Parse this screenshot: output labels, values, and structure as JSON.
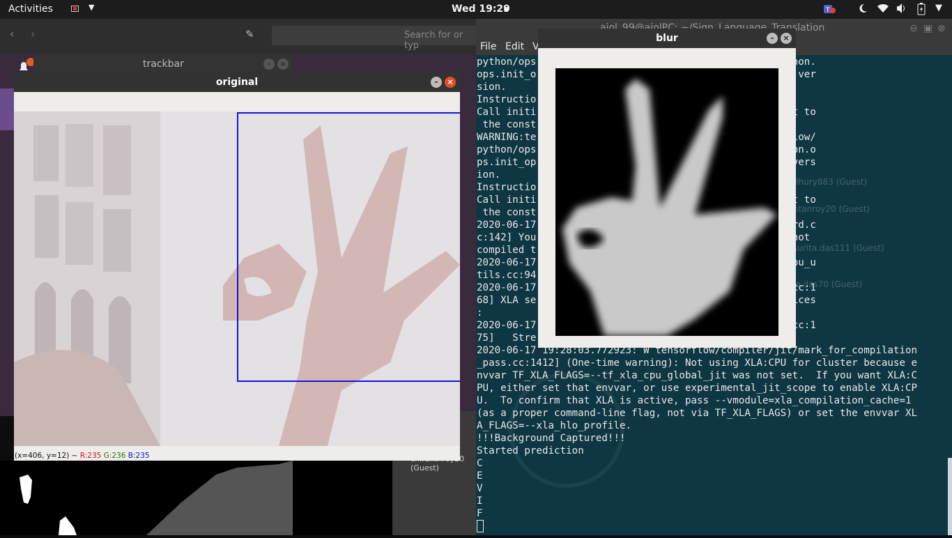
{
  "topbar": {
    "activities": "Activities",
    "clock": "Wed 19:29"
  },
  "browser": {
    "search_placeholder": "Search for or typ"
  },
  "trackbar_window": {
    "title": "trackbar"
  },
  "original_window": {
    "title": "original",
    "status": {
      "coords": "(x=406, y=12) ~ ",
      "r": "R:235",
      "g": "G:236",
      "b": "B:235"
    }
  },
  "blur_window": {
    "title": "blur"
  },
  "terminal": {
    "title": "aiol_99@aiolPC: ~/Sign_Language_Translation",
    "menu": [
      "File",
      "Edit",
      "V"
    ],
    "lines": [
      "python/ops                        from tensorflow.python.",
      "ops.init_o                        removed in a future ver",
      "sion.",
      "Instructio",
      "Call initi                        nstead of passing it to",
      " the const",
      "WARNING:te                        st-packages/tensorflow/",
      "python/ops                        rom tensorflow.python.o",
      "ps.init_op                        emoved in a future vers",
      "ion.",
      "Instructio",
      "Call initi                        nstead of passing it to",
      " the const",
      "2020-06-17                        orm/cpu_feature_guard.c",
      "c:142] You                        sorFlow binary was not ",
      "compiled t",
      "2020-06-17                        orm/profile_utils/cpu_u",
      "tils.cc:94",
      "2020-06-17                        la/service/service.cc:1",
      "68] XLA se                         platform Host. Devices",
      ":",
      "2020-06-17                        la/service/service.cc:1",
      "75]   Stre                        fined>",
      "2020-06-17 19:28:03.772923: W tensorflow/compiler/jit/mark_for_compilation",
      "_pass.cc:1412] (One-time warning): Not using XLA:CPU for cluster because e",
      "nvvar TF_XLA_FLAGS=--tf_xla_cpu_global_jit was not set.  If you want XLA:C",
      "PU, either set that envvar, or use experimental_jit_scope to enable XLA:CP",
      "U.  To confirm that XLA is active, pass --vmodule=xla_compilation_cache=1",
      "(as a proper command-line flag, not via TF_XLA_FLAGS) or set the envvar XL",
      "A_FLAGS=--xla_hlo_profile.",
      "!!!Background Captured!!!",
      "Started prediction",
      "C",
      "E",
      "V",
      "I",
      "F"
    ]
  },
  "ghost": {
    "a": "dhury883 (Guest)",
    "b": "ntanroy20 (Guest)",
    "c": "surita.das111 (Guest)",
    "d": "la.das70 (Guest)",
    "e": "0 (Gu",
    "f": "chiranthroy20 (Guest)"
  },
  "colors": {
    "roi_border": "#1414d6",
    "terminal_bg": "#0f3743",
    "close_button": "#e0502a"
  }
}
